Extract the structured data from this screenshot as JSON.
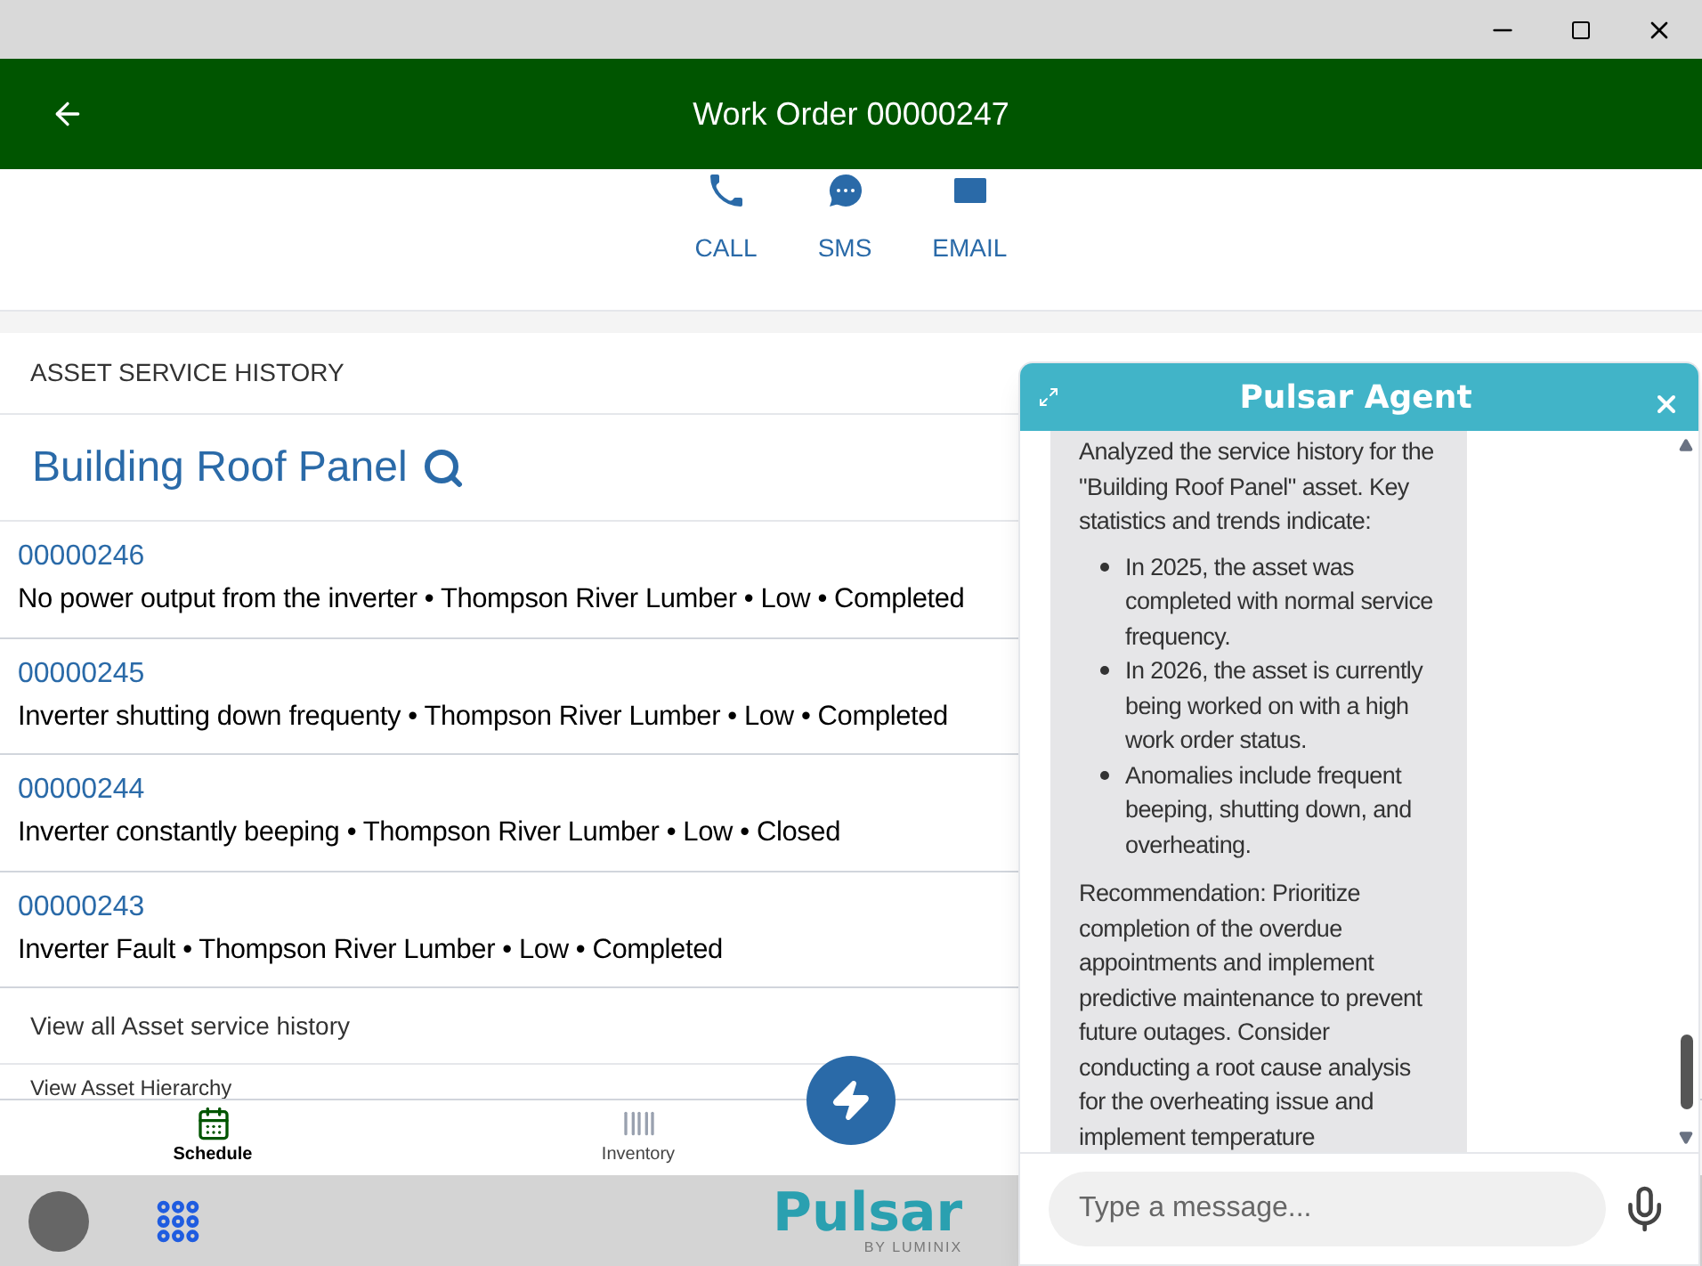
{
  "header": {
    "title": "Work Order 00000247"
  },
  "contact_actions": [
    {
      "kind": "call",
      "label": "CALL"
    },
    {
      "kind": "sms",
      "label": "SMS"
    },
    {
      "kind": "email",
      "label": "EMAIL"
    }
  ],
  "asset_history": {
    "section_title": "ASSET SERVICE HISTORY",
    "asset_name": "Building Roof Panel",
    "work_orders": [
      {
        "number": "00000246",
        "summary": "No power output from the inverter • Thompson River Lumber • Low • Completed"
      },
      {
        "number": "00000245",
        "summary": "Inverter shutting down frequenty • Thompson River Lumber • Low • Completed"
      },
      {
        "number": "00000244",
        "summary": "Inverter constantly beeping • Thompson River Lumber • Low • Closed"
      },
      {
        "number": "00000243",
        "summary": "Inverter Fault • Thompson River Lumber • Low • Completed"
      }
    ],
    "links": [
      "View all Asset service history",
      "View Asset Hierarchy"
    ]
  },
  "bottom_nav": [
    {
      "kind": "calendar",
      "label": "Schedule",
      "selected": true
    },
    {
      "kind": "barcode",
      "label": "Inventory",
      "selected": false
    }
  ],
  "footer": {
    "logo": "Pulsar",
    "logo_tagline": "BY LUMINIX"
  },
  "agent_panel": {
    "title": "Pulsar Agent",
    "message": {
      "intro": "Analyzed the service history for the \"Building Roof Panel\" asset. Key statistics and trends indicate:",
      "bullets": [
        "In 2025, the asset was completed with normal service frequency.",
        "In 2026, the asset is currently being worked on with a high work order status.",
        "Anomalies include frequent beeping, shutting down, and overheating."
      ],
      "recommendation": "Recommendation: Prioritize completion of the overdue appointments and implement predictive maintenance to prevent future outages. Consider conducting a root cause analysis for the overheating issue and implement temperature"
    },
    "input": {
      "placeholder": "Type a message..."
    }
  }
}
